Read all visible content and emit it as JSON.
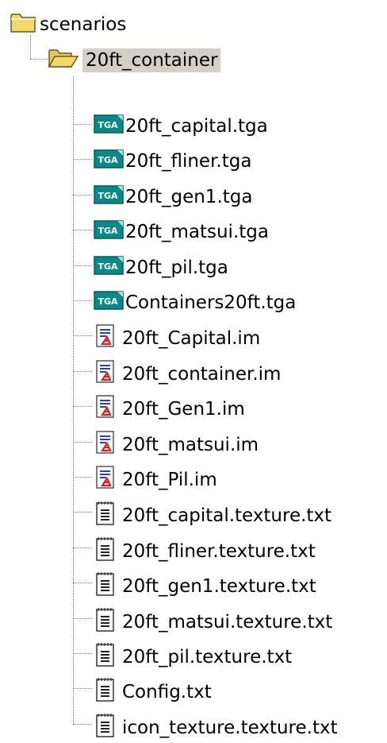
{
  "tree": {
    "root": {
      "label": "scenarios",
      "icon": "folder-icon"
    },
    "folder": {
      "label": "20ft_container",
      "icon": "folder-open-icon",
      "selected": true
    },
    "files": [
      {
        "label": "20ft_capital.tga",
        "icon": "tga-file-icon"
      },
      {
        "label": "20ft_fliner.tga",
        "icon": "tga-file-icon"
      },
      {
        "label": "20ft_gen1.tga",
        "icon": "tga-file-icon"
      },
      {
        "label": "20ft_matsui.tga",
        "icon": "tga-file-icon"
      },
      {
        "label": "20ft_pil.tga",
        "icon": "tga-file-icon"
      },
      {
        "label": "Containers20ft.tga",
        "icon": "tga-file-icon"
      },
      {
        "label": "20ft_Capital.im",
        "icon": "im-file-icon"
      },
      {
        "label": "20ft_container.im",
        "icon": "im-file-icon"
      },
      {
        "label": "20ft_Gen1.im",
        "icon": "im-file-icon"
      },
      {
        "label": "20ft_matsui.im",
        "icon": "im-file-icon"
      },
      {
        "label": "20ft_Pil.im",
        "icon": "im-file-icon"
      },
      {
        "label": "20ft_capital.texture.txt",
        "icon": "text-file-icon"
      },
      {
        "label": "20ft_fliner.texture.txt",
        "icon": "text-file-icon"
      },
      {
        "label": "20ft_gen1.texture.txt",
        "icon": "text-file-icon"
      },
      {
        "label": "20ft_matsui.texture.txt",
        "icon": "text-file-icon"
      },
      {
        "label": "20ft_pil.texture.txt",
        "icon": "text-file-icon"
      },
      {
        "label": "Config.txt",
        "icon": "text-file-icon"
      },
      {
        "label": "icon_texture.texture.txt",
        "icon": "text-file-icon"
      }
    ],
    "tga_badge": "TGA"
  },
  "colors": {
    "selection": "#d4d0c8",
    "folder": "#f3d96b",
    "tga": "#0a8a86",
    "im_accent": "#e02020"
  }
}
